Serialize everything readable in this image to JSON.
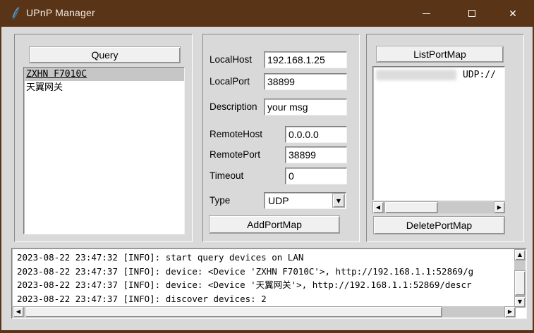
{
  "window": {
    "title": "UPnP Manager",
    "titlebar_color": "#5a3416",
    "controls": {
      "minimize": "–",
      "maximize": "□",
      "close": "✕"
    }
  },
  "left_panel": {
    "query_button": "Query",
    "devices": [
      {
        "label": "ZXHN F7010C",
        "selected": true
      },
      {
        "label": "天翼网关",
        "selected": false
      }
    ]
  },
  "form": {
    "fields": [
      {
        "label": "LocalHost",
        "value": "192.168.1.25"
      },
      {
        "label": "LocalPort",
        "value": "38899"
      },
      {
        "label": "Description",
        "value": "your msg"
      },
      {
        "label": "RemoteHost",
        "value": "0.0.0.0"
      },
      {
        "label": "RemotePort",
        "value": "38899"
      },
      {
        "label": "Timeout",
        "value": "0"
      }
    ],
    "type_label": "Type",
    "type_value": "UDP",
    "add_button": "AddPortMap"
  },
  "right_panel": {
    "list_button": "ListPortMap",
    "portmap_items": [
      {
        "redacted": true,
        "visible_text": "UDP://"
      }
    ],
    "delete_button": "DeletePortMap"
  },
  "log": {
    "lines": [
      "2023-08-22 23:47:32 [INFO]: start query devices on LAN",
      "2023-08-22 23:47:37 [INFO]: device: <Device 'ZXHN F7010C'>, http://192.168.1.1:52869/g",
      "2023-08-22 23:47:37 [INFO]: device: <Device '天翼网关'>, http://192.168.1.1:52869/descr",
      "2023-08-22 23:47:37 [INFO]: discover devices: 2"
    ]
  },
  "icons": {
    "scroll_up": "▲",
    "scroll_down": "▼",
    "scroll_left": "◀",
    "scroll_right": "▶",
    "combo_down": "▼"
  }
}
